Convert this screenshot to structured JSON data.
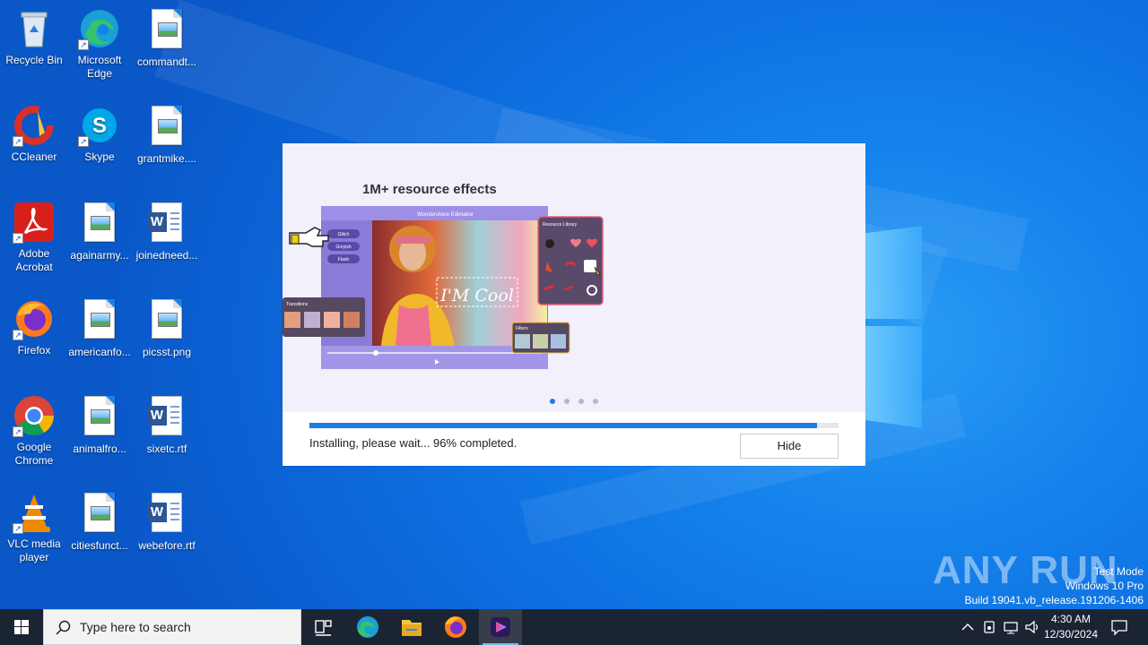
{
  "desktop": {
    "icons": [
      {
        "label": "Recycle Bin",
        "icon": "recycle-bin-icon"
      },
      {
        "label": "Microsoft Edge",
        "icon": "edge-icon"
      },
      {
        "label": "commandt...",
        "icon": "image-file-icon"
      },
      {
        "label": "CCleaner",
        "icon": "ccleaner-icon"
      },
      {
        "label": "Skype",
        "icon": "skype-icon"
      },
      {
        "label": "grantmike....",
        "icon": "image-file-icon"
      },
      {
        "label": "Adobe Acrobat",
        "icon": "acrobat-icon"
      },
      {
        "label": "againarmy...",
        "icon": "image-file-icon"
      },
      {
        "label": "joinedneed...",
        "icon": "word-file-icon"
      },
      {
        "label": "Firefox",
        "icon": "firefox-icon"
      },
      {
        "label": "americanfo...",
        "icon": "image-file-icon"
      },
      {
        "label": "picsst.png",
        "icon": "image-file-icon"
      },
      {
        "label": "Google Chrome",
        "icon": "chrome-icon"
      },
      {
        "label": "animalfro...",
        "icon": "image-file-icon"
      },
      {
        "label": "sixetc.rtf",
        "icon": "word-file-icon"
      },
      {
        "label": "VLC media player",
        "icon": "vlc-icon"
      },
      {
        "label": "citiesfunct...",
        "icon": "image-file-icon"
      },
      {
        "label": "webefore.rtf",
        "icon": "word-file-icon"
      }
    ]
  },
  "installer": {
    "slide_title": "1M+ resource effects",
    "slide_app_title": "Wondershare Edimakor",
    "slide_panel_title": "Resource Library",
    "slide_effects": [
      "Glitch",
      "Greyish",
      "Flash"
    ],
    "slide_caption": "I'M Cool",
    "slide_transitions_label": "Transitions",
    "slide_filters_label": "Filters",
    "slide_count": 4,
    "slide_active": 0,
    "progress_percent": 96,
    "status_text": "Installing, please wait... 96% completed.",
    "hide_label": "Hide"
  },
  "watermark": {
    "brand": "ANY RUN",
    "line1": "Test Mode",
    "line2": "Windows 10 Pro",
    "line3": "Build 19041.vb_release.191206-1406"
  },
  "taskbar": {
    "search_placeholder": "Type here to search",
    "pinned": [
      "task-view-icon",
      "edge-icon",
      "file-explorer-icon",
      "firefox-icon",
      "edimakor-icon"
    ],
    "time": "4:30 AM",
    "date": "12/30/2024"
  },
  "colors": {
    "accent": "#1a7ee6",
    "taskbar": "#1b2433",
    "desktop": "#1583ec"
  }
}
